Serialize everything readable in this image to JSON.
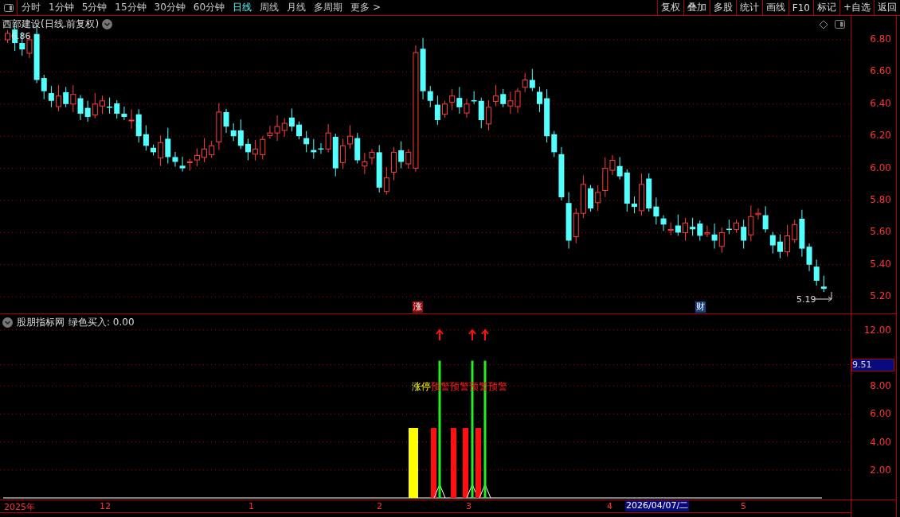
{
  "toolbar": {
    "periods": [
      {
        "label": "分时",
        "selected": false
      },
      {
        "label": "1分钟",
        "selected": false
      },
      {
        "label": "5分钟",
        "selected": false
      },
      {
        "label": "15分钟",
        "selected": false
      },
      {
        "label": "30分钟",
        "selected": false
      },
      {
        "label": "60分钟",
        "selected": false
      },
      {
        "label": "日线",
        "selected": true
      },
      {
        "label": "周线",
        "selected": false
      },
      {
        "label": "月线",
        "selected": false
      },
      {
        "label": "多周期",
        "selected": false
      },
      {
        "label": "更多 >",
        "selected": false
      }
    ],
    "buttons": [
      "复权",
      "叠加",
      "多股",
      "统计",
      "画线",
      "F10",
      "标记",
      "+自选",
      "返回"
    ]
  },
  "price_panel": {
    "title": "西部建设(日线.前复权)",
    "high_label": "6.86",
    "low_label": "5.19",
    "yticks": [
      "6.80",
      "6.60",
      "6.40",
      "6.20",
      "6.00",
      "5.80",
      "5.60",
      "5.40",
      "5.20"
    ],
    "markers": [
      {
        "text": "涨",
        "color": "#9b0c0c"
      },
      {
        "text": "财",
        "color": "#1d3f86"
      }
    ]
  },
  "indicator_panel": {
    "name": "股朋指标网",
    "reading": "绿色买入: 0.00",
    "current_value": "9.51",
    "yticks": [
      "12.00",
      "8.00",
      "6.00",
      "4.00",
      "2.00"
    ],
    "signals": [
      {
        "kind": "limit_up",
        "label": "涨停"
      },
      {
        "kind": "warning",
        "label": "预警"
      },
      {
        "kind": "buy"
      },
      {
        "kind": "warning",
        "label": "预警"
      },
      {
        "kind": "warning",
        "label": "预警"
      },
      {
        "kind": "buy"
      },
      {
        "kind": "warning",
        "label": "预警"
      },
      {
        "kind": "buy"
      }
    ]
  },
  "time_axis": {
    "labels": [
      "2025年",
      "12",
      "1",
      "2",
      "3",
      "4",
      "5"
    ],
    "cursor_date": "2026/04/07/二"
  }
}
